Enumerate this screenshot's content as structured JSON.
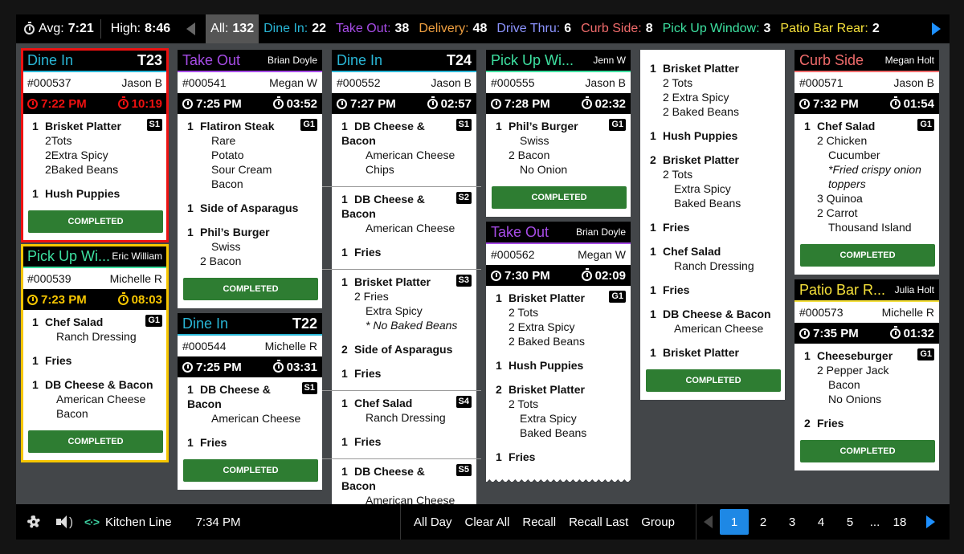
{
  "colors": {
    "dine_in": "#29b6d6",
    "take_out": "#a64ce6",
    "delivery": "#f0a040",
    "drive_thru": "#8c94ff",
    "curb_side": "#f06b6b",
    "pickup": "#3de0a0",
    "patio": "#f5e03a",
    "completed": "#2e7d32",
    "alert_red": "#ee1111",
    "alert_yellow": "#f7c600",
    "accent_blue": "#1e88e5"
  },
  "topbar": {
    "avg_label": "Avg:",
    "avg_value": "7:21",
    "high_label": "High:",
    "high_value": "8:46",
    "filters": [
      {
        "label": "All:",
        "count": "132"
      },
      {
        "label": "Dine In:",
        "count": "22"
      },
      {
        "label": "Take Out:",
        "count": "38"
      },
      {
        "label": "Delivery:",
        "count": "48"
      },
      {
        "label": "Drive Thru:",
        "count": "6"
      },
      {
        "label": "Curb Side:",
        "count": "8"
      },
      {
        "label": "Pick Up Window:",
        "count": "3"
      },
      {
        "label": "Patio Bar Rear:",
        "count": "2"
      }
    ]
  },
  "completed_label": "COMPLETED",
  "tickets": {
    "t1": {
      "type": "Dine In",
      "right": "T23",
      "order": "#000537",
      "server": "Jason B",
      "time": "7:22 PM",
      "timer": "10:19",
      "items": [
        {
          "qty": "1",
          "name": "Brisket Platter",
          "badge": "S1",
          "mods": [
            [
              "2",
              "Tots"
            ],
            [
              "2",
              "Extra Spicy"
            ],
            [
              "2",
              "Baked Beans"
            ]
          ]
        },
        {
          "qty": "1",
          "name": "Hush Puppies"
        }
      ]
    },
    "t2": {
      "type": "Pick Up Wi...",
      "right": "Eric William",
      "order": "#000539",
      "server": "Michelle R",
      "time": "7:23 PM",
      "timer": "08:03",
      "items": [
        {
          "qty": "1",
          "name": "Chef Salad",
          "badge": "G1",
          "mods": [
            "Ranch Dressing"
          ]
        },
        {
          "qty": "1",
          "name": "Fries"
        },
        {
          "qty": "1",
          "name": "DB Cheese & Bacon",
          "mods": [
            "American Cheese",
            "Bacon"
          ]
        }
      ]
    },
    "t3": {
      "type": "Take Out",
      "right": "Brian Doyle",
      "order": "#000541",
      "server": "Megan W",
      "time": "7:25 PM",
      "timer": "03:52",
      "items": [
        {
          "qty": "1",
          "name": "Flatiron Steak",
          "badge": "G1",
          "mods": [
            "Rare",
            "Potato",
            "Sour Cream",
            "Bacon"
          ]
        },
        {
          "qty": "1",
          "name": "Side of Asparagus"
        },
        {
          "qty": "1",
          "name": "Phil’s Burger",
          "mods": [
            "Swiss",
            "2  Bacon"
          ]
        }
      ]
    },
    "t4": {
      "type": "Dine In",
      "right": "T22",
      "order": "#000544",
      "server": "Michelle R",
      "time": "7:25 PM",
      "timer": "03:31",
      "items": [
        {
          "qty": "1",
          "name": "DB Cheese & Bacon",
          "badge": "S1",
          "mods": [
            "American Cheese"
          ]
        },
        {
          "qty": "1",
          "name": "Fries"
        }
      ]
    },
    "t5": {
      "type": "Dine In",
      "right": "T24",
      "order": "#000552",
      "server": "Jason B",
      "time": "7:27 PM",
      "timer": "02:57",
      "segs": [
        {
          "badge": "S1",
          "items": [
            {
              "qty": "1",
              "name": "DB Cheese & Bacon",
              "mods": [
                "American Cheese",
                "Chips"
              ]
            }
          ]
        },
        {
          "badge": "S2",
          "items": [
            {
              "qty": "1",
              "name": "DB Cheese & Bacon",
              "mods": [
                "American Cheese"
              ]
            },
            {
              "qty": "1",
              "name": "Fries"
            }
          ]
        },
        {
          "badge": "S3",
          "items": [
            {
              "qty": "1",
              "name": "Brisket Platter",
              "mods": [
                "2  Fries",
                "Extra Spicy",
                "* No Baked Beans"
              ]
            },
            {
              "qty": "2",
              "name": "Side of Asparagus"
            },
            {
              "qty": "1",
              "name": "Fries"
            }
          ]
        },
        {
          "badge": "S4",
          "items": [
            {
              "qty": "1",
              "name": "Chef Salad",
              "mods": [
                "Ranch Dressing"
              ]
            },
            {
              "qty": "1",
              "name": "Fries"
            }
          ]
        },
        {
          "badge": "S5",
          "items": [
            {
              "qty": "1",
              "name": "DB Cheese & Bacon",
              "mods": [
                "American Cheese"
              ]
            }
          ]
        }
      ]
    },
    "t6": {
      "type": "Pick Up Wi...",
      "right": "Jenn W",
      "order": "#000555",
      "server": "Jason B",
      "time": "7:28 PM",
      "timer": "02:32",
      "items": [
        {
          "qty": "1",
          "name": "Phil’s Burger",
          "badge": "G1",
          "mods": [
            "Swiss",
            "2  Bacon",
            "No Onion"
          ]
        }
      ]
    },
    "t7": {
      "type": "Take Out",
      "right": "Brian Doyle",
      "order": "#000562",
      "server": "Megan W",
      "time": "7:30 PM",
      "timer": "02:09",
      "items": [
        {
          "qty": "1",
          "name": "Brisket Platter",
          "badge": "G1",
          "mods": [
            "2  Tots",
            "2  Extra Spicy",
            "2  Baked Beans"
          ]
        },
        {
          "qty": "1",
          "name": "Hush Puppies"
        },
        {
          "qty": "2",
          "name": "Brisket Platter",
          "mods": [
            "2  Tots",
            "Extra Spicy",
            "Baked Beans"
          ]
        },
        {
          "qty": "1",
          "name": "Fries"
        }
      ]
    },
    "t8": {
      "items": [
        {
          "qty": "1",
          "name": "Brisket Platter",
          "mods": [
            "2  Tots",
            "2  Extra Spicy",
            "2  Baked Beans"
          ]
        },
        {
          "qty": "1",
          "name": "Hush Puppies"
        },
        {
          "qty": "2",
          "name": "Brisket Platter",
          "mods": [
            "2  Tots",
            "Extra Spicy",
            "Baked Beans"
          ]
        },
        {
          "qty": "1",
          "name": "Fries"
        },
        {
          "qty": "1",
          "name": "Chef Salad",
          "mods": [
            "Ranch Dressing"
          ]
        },
        {
          "qty": "1",
          "name": "Fries"
        },
        {
          "qty": "1",
          "name": "DB Cheese & Bacon",
          "mods": [
            "American Cheese"
          ]
        },
        {
          "qty": "1",
          "name": "Brisket Platter"
        }
      ]
    },
    "t9": {
      "type": "Curb Side",
      "right": "Megan Holt",
      "order": "#000571",
      "server": "Jason B",
      "time": "7:32 PM",
      "timer": "01:54",
      "items": [
        {
          "qty": "1",
          "name": "Chef Salad",
          "badge": "G1",
          "mods": [
            "2  Chicken",
            "Cucumber",
            "*Fried crispy onion",
            " toppers",
            "3  Quinoa",
            "2  Carrot",
            "Thousand Island"
          ]
        }
      ]
    },
    "t10": {
      "type": "Patio Bar R...",
      "right": "Julia Holt",
      "order": "#000573",
      "server": "Michelle R",
      "time": "7:35 PM",
      "timer": "01:32",
      "items": [
        {
          "qty": "1",
          "name": "Cheeseburger",
          "badge": "G1",
          "mods": [
            "2  Pepper Jack",
            "Bacon",
            "No Onions"
          ]
        },
        {
          "qty": "2",
          "name": "Fries"
        }
      ]
    }
  },
  "bottombar": {
    "station": "Kitchen Line",
    "time": "7:34 PM",
    "actions": [
      "All Day",
      "Clear All",
      "Recall",
      "Recall Last",
      "Group"
    ],
    "pages": [
      "1",
      "2",
      "3",
      "4",
      "5"
    ],
    "ellipsis": "...",
    "last_page": "18",
    "connection_glyph": "<·>"
  }
}
